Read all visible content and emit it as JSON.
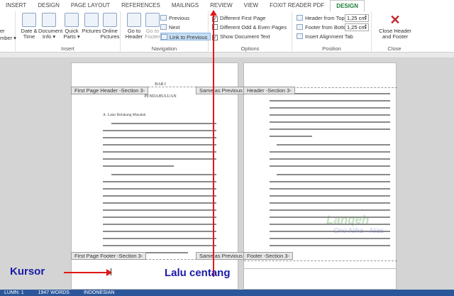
{
  "tabs": [
    "INSERT",
    "DESIGN",
    "PAGE LAYOUT",
    "REFERENCES",
    "MAILINGS",
    "REVIEW",
    "VIEW",
    "FOXIT READER PDF",
    "DESIGN"
  ],
  "ribbon": {
    "insert_group": {
      "label": "Insert",
      "buttons": [
        "Date &",
        "Time",
        "Document",
        "Info ▾",
        "Quick",
        "Parts ▾",
        "Pictures",
        "Online",
        "Pictures"
      ]
    },
    "partial_left": {
      "line1": "er",
      "line2": "mber ▾"
    },
    "navigation_group": {
      "label": "Navigation",
      "go_to_header": [
        "Go to",
        "Header"
      ],
      "go_to_footer": [
        "Go to",
        "Footer"
      ],
      "previous": "Previous",
      "next": "Next",
      "link_to_previous": "Link to Previous"
    },
    "options_group": {
      "label": "Options",
      "different_first_page": "Different First Page",
      "different_odd_even": "Different Odd & Even Pages",
      "show_document_text": "Show Document Text"
    },
    "position_group": {
      "label": "Position",
      "header_from_top": "Header from Top:",
      "header_from_top_value": "1,25 cm",
      "footer_from_bottom": "Footer from Bottom:",
      "footer_from_bottom_value": "1,25 cm",
      "insert_alignment_tab": "Insert Alignment Tab"
    },
    "close_group": {
      "label": "Close",
      "close_button": [
        "Close Header",
        "and Footer"
      ]
    }
  },
  "document": {
    "left_header_tag": "First Page Header -Section 3-",
    "left_same_as_previous": "Same as Previous",
    "right_header_tag": "Header -Section 3-",
    "left_footer_tag": "First Page Footer -Section 3-",
    "left_footer_same": "Same as Previous",
    "right_footer_tag": "Footer -Section 3-",
    "bab": "BAB I",
    "pendahuluan": "PENDAHULUAN",
    "subheading": "A.  Latar Belakang Masalah"
  },
  "annotations": {
    "kursor": "Kursor",
    "lalu_centang": "Lalu centang"
  },
  "watermark": {
    "line1": "Lanqeh",
    "line2": "Ono Niha - Nias"
  },
  "status_bar": {
    "column": "LUMN: 1",
    "words": "1947 WORDS",
    "language": "INDONESIAN"
  },
  "colors": {
    "accent_green": "#1e7d34",
    "status_blue": "#2b579a",
    "annotation_red": "#e01818",
    "annotation_blue": "#1a1aa8"
  }
}
